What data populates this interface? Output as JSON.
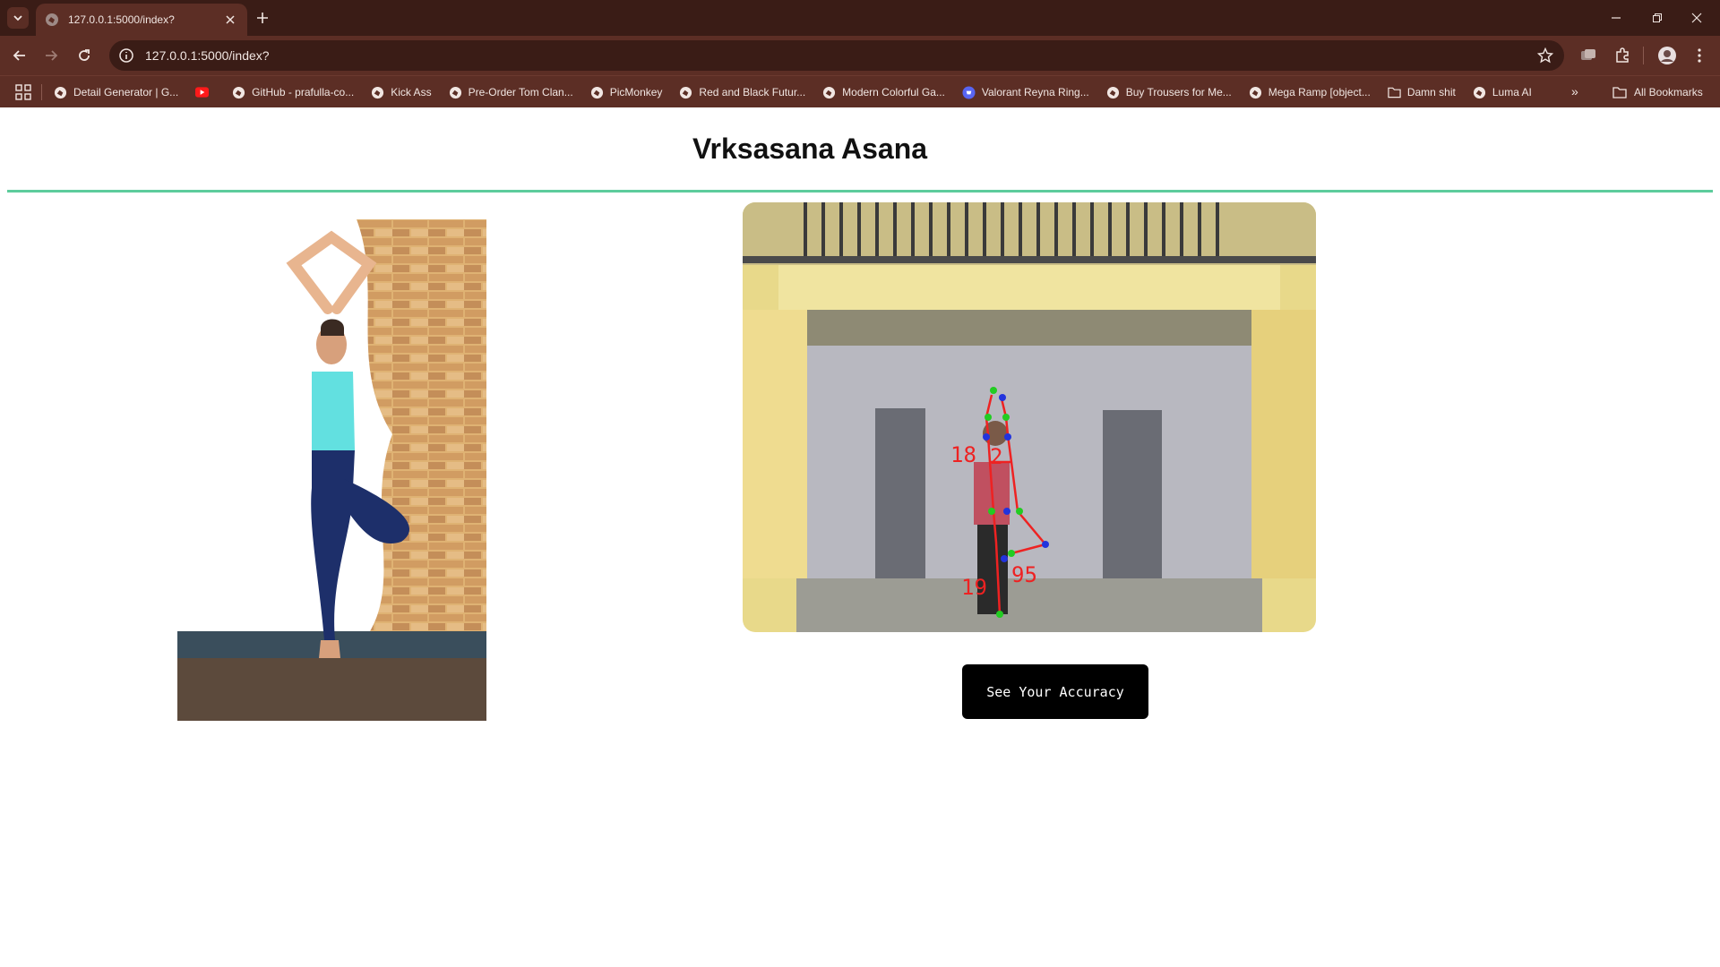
{
  "browser": {
    "tab_title": "127.0.0.1:5000/index?",
    "url": "127.0.0.1:5000/index?",
    "bookmarks": [
      {
        "label": "Detail Generator | G...",
        "icon": "globe-icon"
      },
      {
        "label": "",
        "icon": "youtube-icon"
      },
      {
        "label": "GitHub - prafulla-co...",
        "icon": "globe-icon"
      },
      {
        "label": "Kick Ass",
        "icon": "globe-icon"
      },
      {
        "label": "Pre-Order Tom Clan...",
        "icon": "globe-icon"
      },
      {
        "label": "PicMonkey",
        "icon": "globe-icon"
      },
      {
        "label": "Red and Black Futur...",
        "icon": "globe-icon"
      },
      {
        "label": "Modern Colorful Ga...",
        "icon": "globe-icon"
      },
      {
        "label": "Valorant Reyna Ring...",
        "icon": "discord-icon"
      },
      {
        "label": "Buy Trousers for Me...",
        "icon": "globe-icon"
      },
      {
        "label": "Mega Ramp [object...",
        "icon": "globe-icon"
      },
      {
        "label": "Damn shit",
        "icon": "folder-icon"
      },
      {
        "label": "Luma AI",
        "icon": "globe-icon"
      }
    ],
    "all_bookmarks_label": "All Bookmarks",
    "more_bookmarks": "»"
  },
  "page": {
    "title": "Vrksasana Asana",
    "accent_color": "#5dcc9c",
    "button_label": "See Your Accuracy"
  },
  "camera_feed": {
    "angle_labels": [
      "18",
      "2",
      "19",
      "95"
    ]
  }
}
